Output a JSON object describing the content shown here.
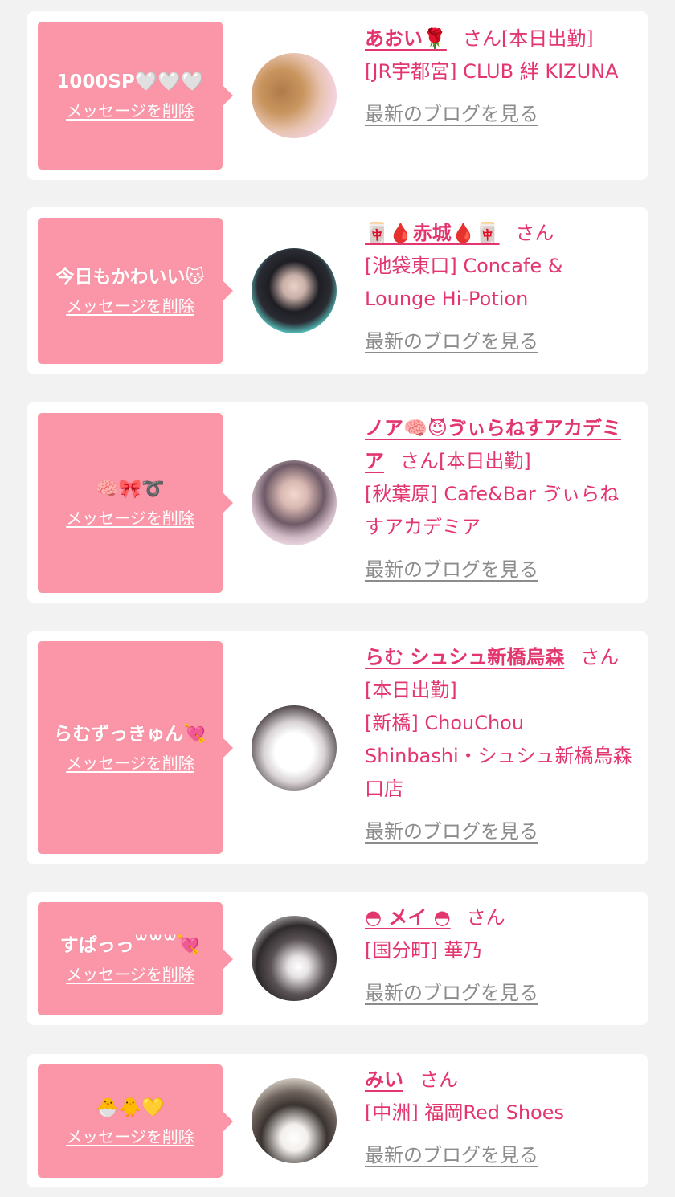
{
  "cards": [
    {
      "bubble_message": "1000SP🤍🤍🤍",
      "delete_label": "メッセージを削除",
      "name": "あおい🌹",
      "honorific": "さん",
      "status": "[本日出勤]",
      "shop": "[JR宇都宮] CLUB 絆 KIZUNA",
      "blog_link": "最新のブログを見る",
      "avatar_colors": [
        "#f3d2de",
        "#b07a4a"
      ]
    },
    {
      "bubble_message": "今日もかわいい😽",
      "delete_label": "メッセージを削除",
      "name": "🀄🩸赤城🩸🀄",
      "honorific": "さん",
      "status": "",
      "shop": "[池袋東口] Concafe & Lounge Hi-Potion",
      "blog_link": "最新のブログを見る",
      "avatar_colors": [
        "#57c9c4",
        "#1e1e24"
      ]
    },
    {
      "bubble_message": "🧠🎀➰",
      "delete_label": "メッセージを削除",
      "name": "ノア🧠😈ゔぃらねすアカデミア",
      "honorific": "さん",
      "status": "[本日出勤]",
      "shop": "[秋葉原] Cafe&Bar ゔぃらねすアカデミア",
      "blog_link": "最新のブログを見る",
      "avatar_colors": [
        "#f0dde4",
        "#6e5a66"
      ]
    },
    {
      "bubble_message": "らむずっきゅん💘",
      "delete_label": "メッセージを削除",
      "name": "らむ シュシュ新橋烏森",
      "honorific": "さん",
      "status": "[本日出勤]",
      "shop": "[新橋] ChouChou Shinbashi・シュシュ新橋烏森口店",
      "blog_link": "最新のブログを見る",
      "avatar_colors": [
        "#ffffff",
        "#3b3236"
      ]
    },
    {
      "bubble_message": "すぱっっ꒳꒳꒳💘",
      "delete_label": "メッセージを削除",
      "name": "◓ メイ ◓",
      "honorific": "さん",
      "status": "",
      "shop": "[国分町] 華乃",
      "blog_link": "最新のブログを見る",
      "avatar_colors": [
        "#d8d4d6",
        "#2e2a2c"
      ]
    },
    {
      "bubble_message": "🐣🐥💛",
      "delete_label": "メッセージを削除",
      "name": "みい",
      "honorific": "さん",
      "status": "",
      "shop": "[中洲] 福岡Red Shoes",
      "blog_link": "最新のブログを見る",
      "avatar_colors": [
        "#e2dcd2",
        "#3a3330"
      ]
    }
  ],
  "colors": {
    "accent": "#e3356e",
    "bubble": "#fb96a8",
    "blog_link": "#8c8c8c",
    "background": "#f2f2f2"
  }
}
